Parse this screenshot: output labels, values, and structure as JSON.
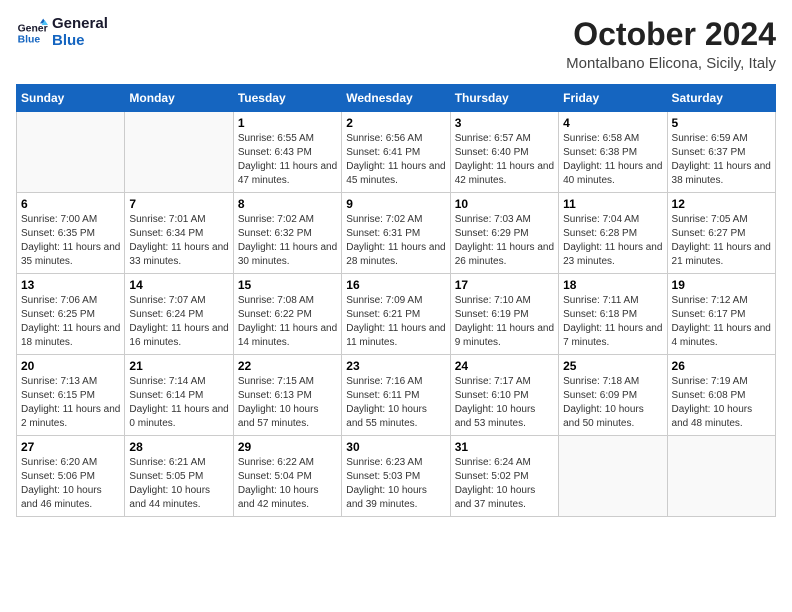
{
  "header": {
    "logo_line1": "General",
    "logo_line2": "Blue",
    "month": "October 2024",
    "location": "Montalbano Elicona, Sicily, Italy"
  },
  "days_of_week": [
    "Sunday",
    "Monday",
    "Tuesday",
    "Wednesday",
    "Thursday",
    "Friday",
    "Saturday"
  ],
  "weeks": [
    [
      {
        "day": "",
        "info": ""
      },
      {
        "day": "",
        "info": ""
      },
      {
        "day": "1",
        "info": "Sunrise: 6:55 AM\nSunset: 6:43 PM\nDaylight: 11 hours and 47 minutes."
      },
      {
        "day": "2",
        "info": "Sunrise: 6:56 AM\nSunset: 6:41 PM\nDaylight: 11 hours and 45 minutes."
      },
      {
        "day": "3",
        "info": "Sunrise: 6:57 AM\nSunset: 6:40 PM\nDaylight: 11 hours and 42 minutes."
      },
      {
        "day": "4",
        "info": "Sunrise: 6:58 AM\nSunset: 6:38 PM\nDaylight: 11 hours and 40 minutes."
      },
      {
        "day": "5",
        "info": "Sunrise: 6:59 AM\nSunset: 6:37 PM\nDaylight: 11 hours and 38 minutes."
      }
    ],
    [
      {
        "day": "6",
        "info": "Sunrise: 7:00 AM\nSunset: 6:35 PM\nDaylight: 11 hours and 35 minutes."
      },
      {
        "day": "7",
        "info": "Sunrise: 7:01 AM\nSunset: 6:34 PM\nDaylight: 11 hours and 33 minutes."
      },
      {
        "day": "8",
        "info": "Sunrise: 7:02 AM\nSunset: 6:32 PM\nDaylight: 11 hours and 30 minutes."
      },
      {
        "day": "9",
        "info": "Sunrise: 7:02 AM\nSunset: 6:31 PM\nDaylight: 11 hours and 28 minutes."
      },
      {
        "day": "10",
        "info": "Sunrise: 7:03 AM\nSunset: 6:29 PM\nDaylight: 11 hours and 26 minutes."
      },
      {
        "day": "11",
        "info": "Sunrise: 7:04 AM\nSunset: 6:28 PM\nDaylight: 11 hours and 23 minutes."
      },
      {
        "day": "12",
        "info": "Sunrise: 7:05 AM\nSunset: 6:27 PM\nDaylight: 11 hours and 21 minutes."
      }
    ],
    [
      {
        "day": "13",
        "info": "Sunrise: 7:06 AM\nSunset: 6:25 PM\nDaylight: 11 hours and 18 minutes."
      },
      {
        "day": "14",
        "info": "Sunrise: 7:07 AM\nSunset: 6:24 PM\nDaylight: 11 hours and 16 minutes."
      },
      {
        "day": "15",
        "info": "Sunrise: 7:08 AM\nSunset: 6:22 PM\nDaylight: 11 hours and 14 minutes."
      },
      {
        "day": "16",
        "info": "Sunrise: 7:09 AM\nSunset: 6:21 PM\nDaylight: 11 hours and 11 minutes."
      },
      {
        "day": "17",
        "info": "Sunrise: 7:10 AM\nSunset: 6:19 PM\nDaylight: 11 hours and 9 minutes."
      },
      {
        "day": "18",
        "info": "Sunrise: 7:11 AM\nSunset: 6:18 PM\nDaylight: 11 hours and 7 minutes."
      },
      {
        "day": "19",
        "info": "Sunrise: 7:12 AM\nSunset: 6:17 PM\nDaylight: 11 hours and 4 minutes."
      }
    ],
    [
      {
        "day": "20",
        "info": "Sunrise: 7:13 AM\nSunset: 6:15 PM\nDaylight: 11 hours and 2 minutes."
      },
      {
        "day": "21",
        "info": "Sunrise: 7:14 AM\nSunset: 6:14 PM\nDaylight: 11 hours and 0 minutes."
      },
      {
        "day": "22",
        "info": "Sunrise: 7:15 AM\nSunset: 6:13 PM\nDaylight: 10 hours and 57 minutes."
      },
      {
        "day": "23",
        "info": "Sunrise: 7:16 AM\nSunset: 6:11 PM\nDaylight: 10 hours and 55 minutes."
      },
      {
        "day": "24",
        "info": "Sunrise: 7:17 AM\nSunset: 6:10 PM\nDaylight: 10 hours and 53 minutes."
      },
      {
        "day": "25",
        "info": "Sunrise: 7:18 AM\nSunset: 6:09 PM\nDaylight: 10 hours and 50 minutes."
      },
      {
        "day": "26",
        "info": "Sunrise: 7:19 AM\nSunset: 6:08 PM\nDaylight: 10 hours and 48 minutes."
      }
    ],
    [
      {
        "day": "27",
        "info": "Sunrise: 6:20 AM\nSunset: 5:06 PM\nDaylight: 10 hours and 46 minutes."
      },
      {
        "day": "28",
        "info": "Sunrise: 6:21 AM\nSunset: 5:05 PM\nDaylight: 10 hours and 44 minutes."
      },
      {
        "day": "29",
        "info": "Sunrise: 6:22 AM\nSunset: 5:04 PM\nDaylight: 10 hours and 42 minutes."
      },
      {
        "day": "30",
        "info": "Sunrise: 6:23 AM\nSunset: 5:03 PM\nDaylight: 10 hours and 39 minutes."
      },
      {
        "day": "31",
        "info": "Sunrise: 6:24 AM\nSunset: 5:02 PM\nDaylight: 10 hours and 37 minutes."
      },
      {
        "day": "",
        "info": ""
      },
      {
        "day": "",
        "info": ""
      }
    ]
  ]
}
